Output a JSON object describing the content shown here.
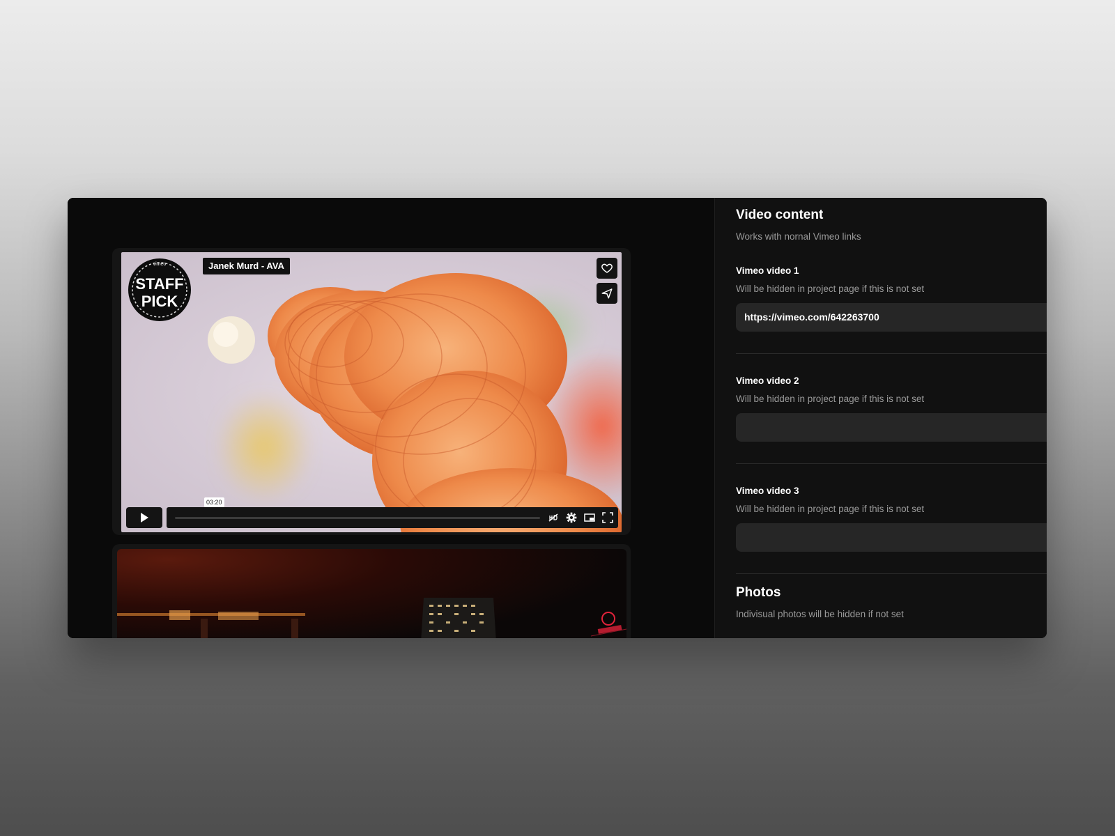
{
  "player": {
    "video_title": "Janek Murd - AVA",
    "staff_pick_text": [
      "STAFF",
      "PICK"
    ],
    "brand": "vimeo",
    "timestamp": "03:20",
    "play_icon": "play-icon",
    "icons": [
      "heart-icon",
      "share-icon",
      "hd-icon",
      "gear-icon",
      "pip-icon",
      "fullscreen-icon"
    ]
  },
  "panel": {
    "video_section": {
      "title": "Video content",
      "description": "Works with nornal Vimeo links"
    },
    "fields": [
      {
        "label": "Vimeo video 1",
        "hint": "Will be hidden in project page if this is not set",
        "value": "https://vimeo.com/642263700"
      },
      {
        "label": "Vimeo video 2",
        "hint": "Will be hidden in project page if this is not set",
        "value": ""
      },
      {
        "label": "Vimeo video 3",
        "hint": "Will be hidden in project page if this is not set",
        "value": ""
      }
    ],
    "photos_section": {
      "title": "Photos",
      "description": "Indivisual photos will be hidden if not set"
    }
  },
  "colors": {
    "window_bg": "#0a0a0a",
    "panel_bg": "#111111",
    "field_bg": "#262626",
    "muted_text": "#9a9a9a"
  }
}
